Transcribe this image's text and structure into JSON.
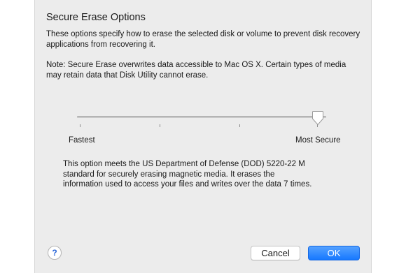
{
  "dialog": {
    "title": "Secure Erase Options",
    "description": "These options specify how to erase the selected disk or volume to prevent disk recovery applications from recovering it.",
    "note": "Note: Secure Erase overwrites data accessible to Mac OS X.  Certain types of media may retain data that Disk Utility cannot erase."
  },
  "slider": {
    "min_label": "Fastest",
    "max_label": "Most Secure",
    "positions": 4,
    "selected_index": 3
  },
  "info_text": "This option meets the US Department of Defense (DOD) 5220-22 M standard for securely erasing magnetic media. It erases the information used to access your files and writes over the data 7 times.",
  "buttons": {
    "help_label": "?",
    "cancel_label": "Cancel",
    "ok_label": "OK"
  },
  "colors": {
    "accent": "#1678ff",
    "dialog_background": "#ececec"
  }
}
